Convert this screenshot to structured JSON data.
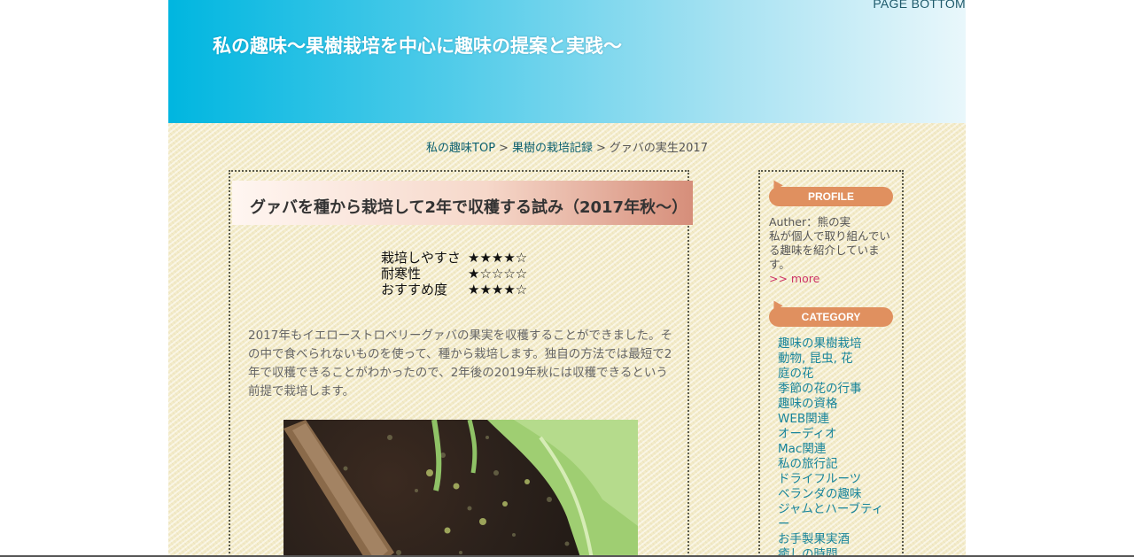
{
  "header": {
    "page_bottom": "PAGE BOTTOM",
    "site_title": "私の趣味〜果樹栽培を中心に趣味の提案と実践〜"
  },
  "breadcrumb": {
    "home": "私の趣味TOP",
    "separator": ">",
    "section": "果樹の栽培記録",
    "current": "グァバの実生2017"
  },
  "article": {
    "title": "グァバを種から栽培して2年で収穫する試み（2017年秋〜）",
    "ratings": [
      {
        "label": "栽培しやすさ",
        "stars": "★★★★☆"
      },
      {
        "label": "耐寒性",
        "stars": "★☆☆☆☆"
      },
      {
        "label": "おすすめ度",
        "stars": "★★★★☆"
      }
    ],
    "intro": "2017年もイエローストロベリーグァバの果実を収穫することができました。その中で食べられないものを使って、種から栽培します。独自の方法では最短で2年で収穫できることがわかったので、2年後の2019年秋には収穫できるという前提で栽培します。"
  },
  "sidebar": {
    "profile_heading": "PROFILE",
    "profile_text": "Auther：熊の実\n私が個人で取り組んでいる趣味を紹介しています。",
    "profile_more": ">> more",
    "category_heading": "CATEGORY",
    "categories": [
      "趣味の果樹栽培",
      "動物, 昆虫, 花",
      "庭の花",
      "季節の花の行事",
      "趣味の資格",
      "WEB関連",
      "オーディオ",
      "Mac関連",
      "私の旅行記",
      "ドライフルーツ",
      "ベランダの趣味",
      "ジャムとハーブティー",
      "お手製果実酒",
      "癒しの時間"
    ]
  },
  "colors": {
    "header_start": "#00b6e0",
    "header_end": "#e9f7fb",
    "link": "#17849a",
    "sidebar_heading": "#e0905f",
    "more_link": "#cc3366"
  }
}
